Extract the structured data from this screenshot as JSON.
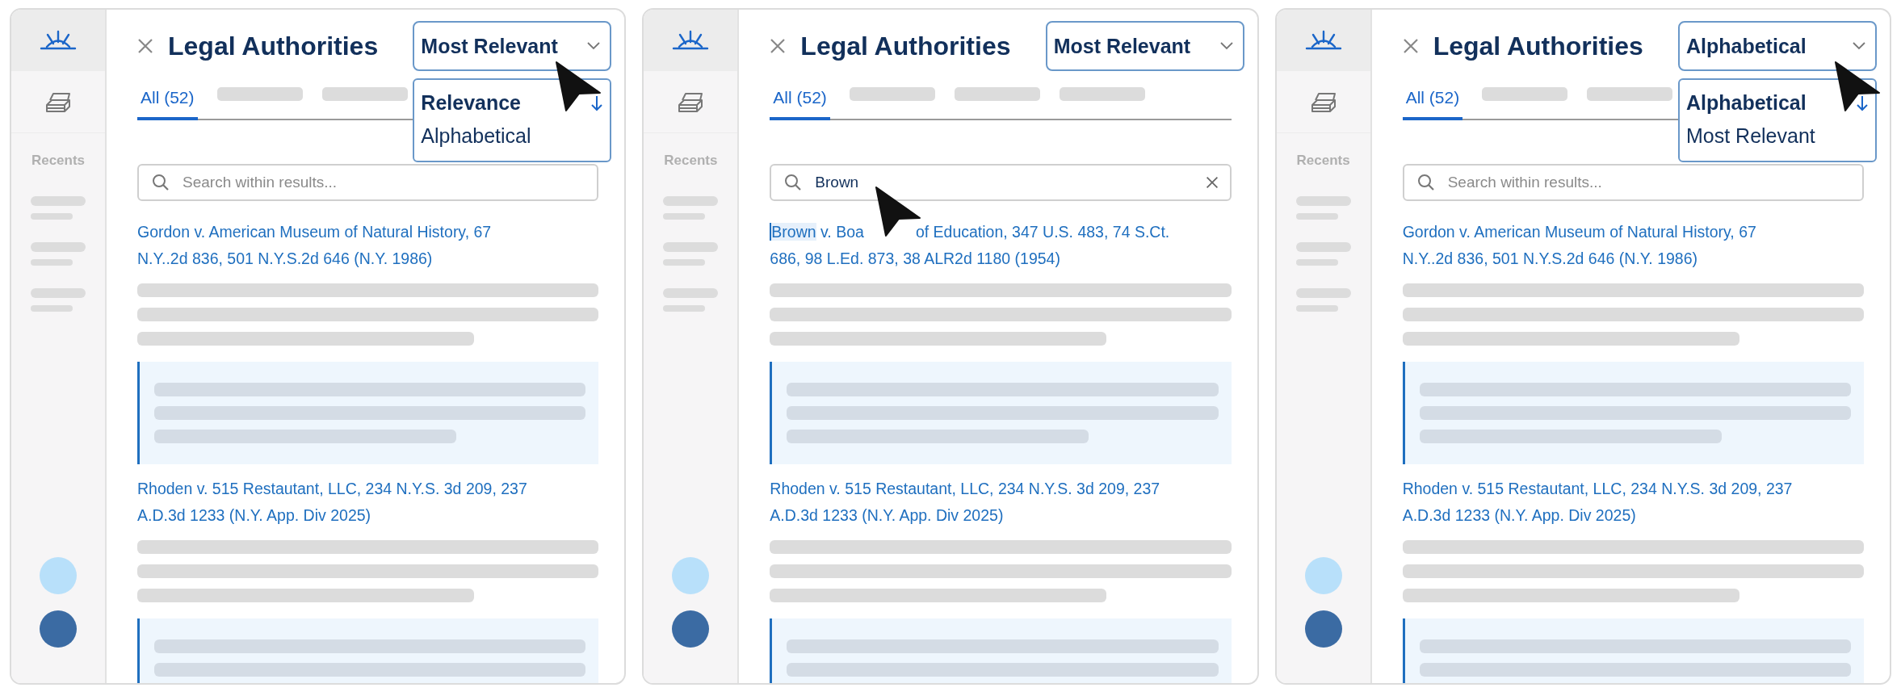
{
  "panels": [
    {
      "sidebar": {
        "section_label": "Recents",
        "avatars": [
          {
            "color": "#b8e0fa"
          },
          {
            "color": "#3b6ba3"
          }
        ]
      },
      "title": "Legal Authorities",
      "sort": {
        "value": "Most Relevant",
        "open": true,
        "pointer": true,
        "options": [
          {
            "label": "Relevance",
            "selected": true
          },
          {
            "label": "Alphabetical",
            "selected": false
          }
        ]
      },
      "tabs": [
        {
          "label": "All (52)",
          "selected": true
        }
      ],
      "search": {
        "placeholder": "Search within results..."
      },
      "results": [
        {
          "parts": [
            {
              "kind": "text",
              "text": "Gordon v. American Museum of Natural History, 67\nN.Y..2d 836, 501 N.Y.S.2d 646 (N.Y. 1986)",
              "highlighted": false
            }
          ]
        },
        {
          "parts": [
            {
              "kind": "text",
              "text": "Rhoden v. 515 Restautant, LLC, 234 N.Y.S. 3d 209, 237\nA.D.3d 1233 (N.Y. App. Div 2025)",
              "highlighted": false
            }
          ]
        }
      ]
    },
    {
      "sidebar": {
        "section_label": "Recents",
        "avatars": [
          {
            "color": "#b8e0fa"
          },
          {
            "color": "#3b6ba3"
          }
        ]
      },
      "title": "Legal Authorities",
      "sort": {
        "value": "Most Relevant"
      },
      "tabs": [
        {
          "label": "All (52)",
          "selected": true
        }
      ],
      "search": {
        "value": "Brown",
        "pointer": true
      },
      "results": [
        {
          "parts": [
            {
              "kind": "text",
              "text": "Brown",
              "highlighted": true
            },
            {
              "kind": "text",
              "text": " v. Boa",
              "highlighted": false
            },
            {
              "kind": "cursor"
            },
            {
              "kind": "text",
              "text": "of Education, 347 U.S. 483, 74 S.Ct.\n686, 98 L.Ed. 873, 38 ALR2d 1180 (1954)",
              "highlighted": false
            }
          ]
        },
        {
          "parts": [
            {
              "kind": "text",
              "text": "Rhoden v. 515 Restautant, LLC, 234 N.Y.S. 3d 209, 237\nA.D.3d 1233 (N.Y. App. Div 2025)",
              "highlighted": false
            }
          ]
        }
      ]
    },
    {
      "sidebar": {
        "section_label": "Recents",
        "avatars": [
          {
            "color": "#b8e0fa"
          },
          {
            "color": "#3b6ba3"
          }
        ]
      },
      "title": "Legal Authorities",
      "sort": {
        "value": "Alphabetical",
        "open": true,
        "pointer": true,
        "options": [
          {
            "label": "Alphabetical",
            "selected": true
          },
          {
            "label": "Most Relevant",
            "selected": false
          }
        ]
      },
      "tabs": [
        {
          "label": "All (52)",
          "selected": true
        }
      ],
      "search": {
        "placeholder": "Search within results..."
      },
      "results": [
        {
          "parts": [
            {
              "kind": "text",
              "text": "Gordon v. American Museum of Natural History, 67\nN.Y..2d 836, 501 N.Y.S.2d 646 (N.Y. 1986)",
              "highlighted": false
            }
          ]
        },
        {
          "parts": [
            {
              "kind": "text",
              "text": "Rhoden v. 515 Restautant, LLC, 234 N.Y.S. 3d 209, 237\nA.D.3d 1233 (N.Y. App. Div 2025)",
              "highlighted": false
            }
          ]
        }
      ]
    }
  ]
}
